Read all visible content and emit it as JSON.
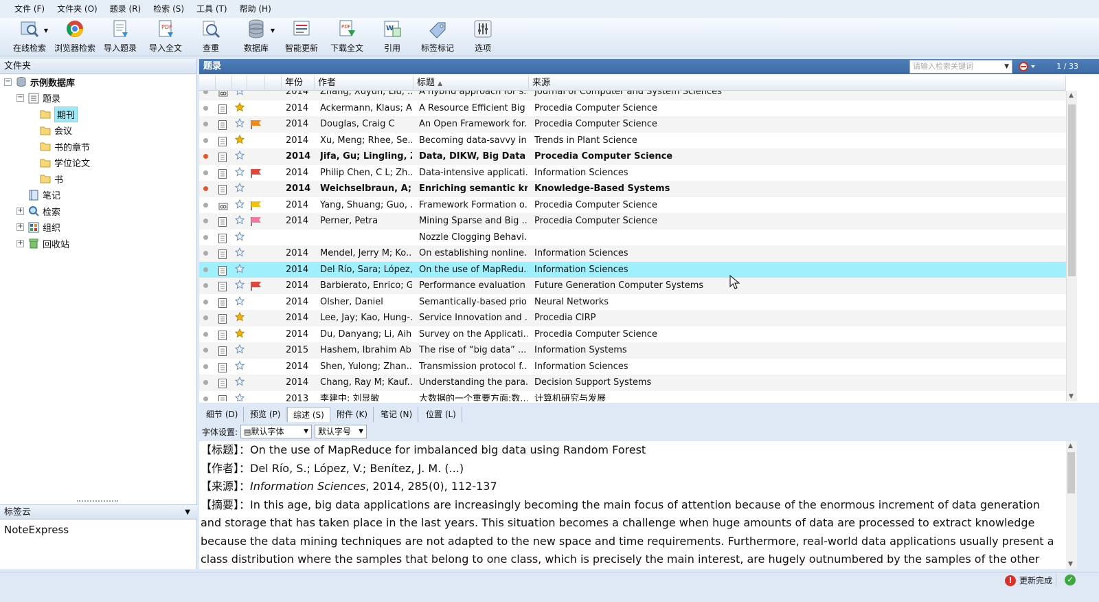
{
  "menu": [
    {
      "label": "文件 (F)"
    },
    {
      "label": "文件夹 (O)"
    },
    {
      "label": "题录 (R)"
    },
    {
      "label": "检索 (S)"
    },
    {
      "label": "工具 (T)"
    },
    {
      "label": "帮助 (H)"
    }
  ],
  "toolbar": [
    {
      "label": "在线检索",
      "icon": "online-search-icon",
      "dropdown": true
    },
    {
      "label": "浏览器检索",
      "icon": "browser-search-icon"
    },
    {
      "label": "导入题录",
      "icon": "import-records-icon"
    },
    {
      "label": "导入全文",
      "icon": "import-fulltext-icon"
    },
    {
      "label": "查重",
      "icon": "find-duplicates-icon"
    },
    {
      "label": "数据库",
      "icon": "database-icon",
      "dropdown": true
    },
    {
      "label": "智能更新",
      "icon": "smart-update-icon"
    },
    {
      "label": "下载全文",
      "icon": "download-fulltext-icon"
    },
    {
      "label": "引用",
      "icon": "cite-icon"
    },
    {
      "label": "标签标记",
      "icon": "tag-icon"
    },
    {
      "label": "选项",
      "icon": "options-icon"
    }
  ],
  "left": {
    "header": "文件夹",
    "tree": {
      "db": "示例数据库",
      "records": "题录",
      "journal": "期刊",
      "conference": "会议",
      "chapter": "书的章节",
      "thesis": "学位论文",
      "book": "书",
      "notes": "笔记",
      "search": "检索",
      "organize": "组织",
      "recycle": "回收站"
    },
    "tagcloud_header": "标签云",
    "tagcloud_item": "NoteExpress"
  },
  "records": {
    "header": "题录",
    "search_placeholder": "请输入检索关键词",
    "page": "1 / 33",
    "columns": {
      "year": "年份",
      "author": "作者",
      "title": "标题",
      "source": "来源"
    },
    "rows": [
      {
        "year": "2014",
        "author": "Zhang, Xuyun; Liu, ...",
        "title": "A hybrid approach for s...",
        "source": "Journal of Computer and System Sciences",
        "read": true,
        "star": "empty",
        "flag": "",
        "icon": "link"
      },
      {
        "year": "2014",
        "author": "Ackermann, Klaus; A...",
        "title": "A Resource Efficient Big ...",
        "source": "Procedia Computer Science",
        "read": true,
        "star": "gold",
        "flag": "",
        "icon": "doc"
      },
      {
        "year": "2014",
        "author": "Douglas, Craig C",
        "title": "An Open Framework for...",
        "source": "Procedia Computer Science",
        "read": true,
        "star": "empty",
        "flag": "orange",
        "icon": "doc"
      },
      {
        "year": "2014",
        "author": "Xu, Meng; Rhee, Se...",
        "title": "Becoming data-savvy in...",
        "source": "Trends in Plant Science",
        "read": true,
        "star": "gold",
        "flag": "",
        "icon": "doc"
      },
      {
        "year": "2014",
        "author": "Jifa, Gu; Lingling, Zh",
        "title": "Data, DIKW, Big Data an",
        "source": "Procedia Computer Science",
        "read": false,
        "star": "empty",
        "flag": "",
        "icon": "doc"
      },
      {
        "year": "2014",
        "author": "Philip Chen, C L; Zh...",
        "title": "Data-intensive applicati...",
        "source": "Information Sciences",
        "read": true,
        "star": "empty",
        "flag": "red",
        "icon": "doc"
      },
      {
        "year": "2014",
        "author": "Weichselbraun, A; G",
        "title": "Enriching semantic kno...",
        "source": "Knowledge-Based Systems",
        "read": false,
        "star": "empty",
        "flag": "",
        "icon": "doc"
      },
      {
        "year": "2014",
        "author": "Yang, Shuang; Guo, ...",
        "title": "Framework Formation o...",
        "source": "Procedia Computer Science",
        "read": true,
        "star": "empty",
        "flag": "yellow",
        "icon": "link"
      },
      {
        "year": "2014",
        "author": "Perner, Petra",
        "title": "Mining Sparse and Big ...",
        "source": "Procedia Computer Science",
        "read": true,
        "star": "empty",
        "flag": "pink",
        "icon": "doc"
      },
      {
        "year": "",
        "author": "",
        "title": "Nozzle Clogging Behavi...",
        "source": "",
        "read": true,
        "star": "empty",
        "flag": "",
        "icon": "doc"
      },
      {
        "year": "2014",
        "author": "Mendel, Jerry M; Ko...",
        "title": "On establishing nonline...",
        "source": "Information Sciences",
        "read": true,
        "star": "empty",
        "flag": "",
        "icon": "doc"
      },
      {
        "year": "2014",
        "author": "Del Río, Sara; López,...",
        "title": "On the use of MapRedu...",
        "source": "Information Sciences",
        "read": true,
        "star": "empty",
        "flag": "",
        "icon": "doc",
        "selected": true
      },
      {
        "year": "2014",
        "author": "Barbierato, Enrico; G...",
        "title": "Performance evaluation ...",
        "source": "Future Generation Computer Systems",
        "read": true,
        "star": "empty",
        "flag": "red",
        "icon": "doc"
      },
      {
        "year": "2014",
        "author": "Olsher, Daniel",
        "title": "Semantically-based prio...",
        "source": "Neural Networks",
        "read": true,
        "star": "empty",
        "flag": "",
        "icon": "doc"
      },
      {
        "year": "2014",
        "author": "Lee, Jay; Kao, Hung-...",
        "title": "Service Innovation and ...",
        "source": "Procedia CIRP",
        "read": true,
        "star": "gold",
        "flag": "",
        "icon": "doc"
      },
      {
        "year": "2014",
        "author": "Du, Danyang; Li, Aih...",
        "title": "Survey on the Applicati...",
        "source": "Procedia Computer Science",
        "read": true,
        "star": "gold",
        "flag": "",
        "icon": "doc"
      },
      {
        "year": "2015",
        "author": "Hashem, Ibrahim Ab...",
        "title": "The rise of “big data” ...",
        "source": "Information Systems",
        "read": true,
        "star": "empty",
        "flag": "",
        "icon": "doc"
      },
      {
        "year": "2014",
        "author": "Shen, Yulong; Zhan...",
        "title": "Transmission protocol f...",
        "source": "Information Sciences",
        "read": true,
        "star": "empty",
        "flag": "",
        "icon": "doc"
      },
      {
        "year": "2014",
        "author": "Chang, Ray M; Kauf...",
        "title": "Understanding the para...",
        "source": "Decision Support Systems",
        "read": true,
        "star": "empty",
        "flag": "",
        "icon": "doc"
      },
      {
        "year": "2013",
        "author": "李建中; 刘显敏",
        "title": "大数据的一个重要方面:数...",
        "source": "计算机研究与发展",
        "read": true,
        "star": "empty",
        "flag": "",
        "icon": "doc"
      }
    ]
  },
  "tabs": [
    {
      "label": "细节 (D)"
    },
    {
      "label": "预览 (P)"
    },
    {
      "label": "综述 (S)",
      "active": true
    },
    {
      "label": "附件 (K)"
    },
    {
      "label": "笔记 (N)"
    },
    {
      "label": "位置 (L)"
    }
  ],
  "fontbar": {
    "label": "字体设置:",
    "font": "默认字体",
    "size": "默认字号"
  },
  "detail": {
    "title_label": "【标题】",
    "title": "：On the use of MapReduce for imbalanced big data using Random Forest",
    "author_label": "【作者】",
    "author": "：Del Río, S.; López, V.; Benítez, J. M. (...)",
    "source_label": "【来源】",
    "source_journal": "Information Sciences",
    "source_rest": ", 2014, 285(0), 112-137",
    "abstract_label": "【摘要】",
    "abstract": "：In this age, big data applications are increasingly becoming the main focus of attention because of the enormous increment of data generation and storage that has taken place in the last years. This situation becomes a challenge when huge amounts of data are processed to extract knowledge because the data mining techniques are not adapted to the new space and time requirements. Furthermore, real-world data applications usually present a class distribution where the samples that belong to one class, which is precisely the main interest, are hugely outnumbered by the samples of the other classes. This circumstance, known as the class"
  },
  "status": {
    "text": "更新完成"
  },
  "colors": {
    "accent": "#3b6aa5",
    "selected_row": "#9ff0fc",
    "unread_dot": "#e8552a",
    "star": "#f2b705"
  }
}
